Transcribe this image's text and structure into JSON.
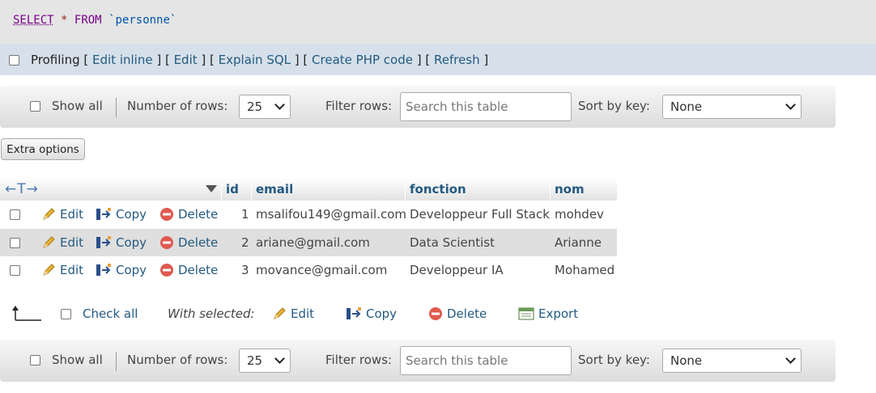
{
  "sql": {
    "select": "SELECT",
    "star": "*",
    "from": "FROM",
    "table": "`personne`"
  },
  "profiling": {
    "label": "Profiling",
    "links": [
      "Edit inline",
      "Edit",
      "Explain SQL",
      "Create PHP code",
      "Refresh"
    ]
  },
  "nav": {
    "show_all": "Show all",
    "rows_label": "Number of rows:",
    "rows_value": "25",
    "filter_label": "Filter rows:",
    "filter_placeholder": "Search this table",
    "sort_label": "Sort by key:",
    "sort_value": "None"
  },
  "extra_options": "Extra options",
  "table": {
    "arrows": "←T→",
    "columns": [
      "id",
      "email",
      "fonction",
      "nom"
    ],
    "actions": {
      "edit": "Edit",
      "copy": "Copy",
      "delete": "Delete"
    },
    "rows": [
      {
        "id": "1",
        "email": "msalifou149@gmail.com",
        "fonction": "Developpeur Full Stack",
        "nom": "mohdev"
      },
      {
        "id": "2",
        "email": "ariane@gmail.com",
        "fonction": "Data Scientist",
        "nom": "Arianne"
      },
      {
        "id": "3",
        "email": "movance@gmail.com",
        "fonction": "Developpeur IA",
        "nom": "Mohamed"
      }
    ]
  },
  "bulk": {
    "check_all": "Check all",
    "with_selected": "With selected:",
    "edit": "Edit",
    "copy": "Copy",
    "delete": "Delete",
    "export": "Export"
  },
  "colors": {
    "link": "#235a81",
    "sql_keyword": "#770088",
    "profiling_bg": "#d6e0ea"
  }
}
